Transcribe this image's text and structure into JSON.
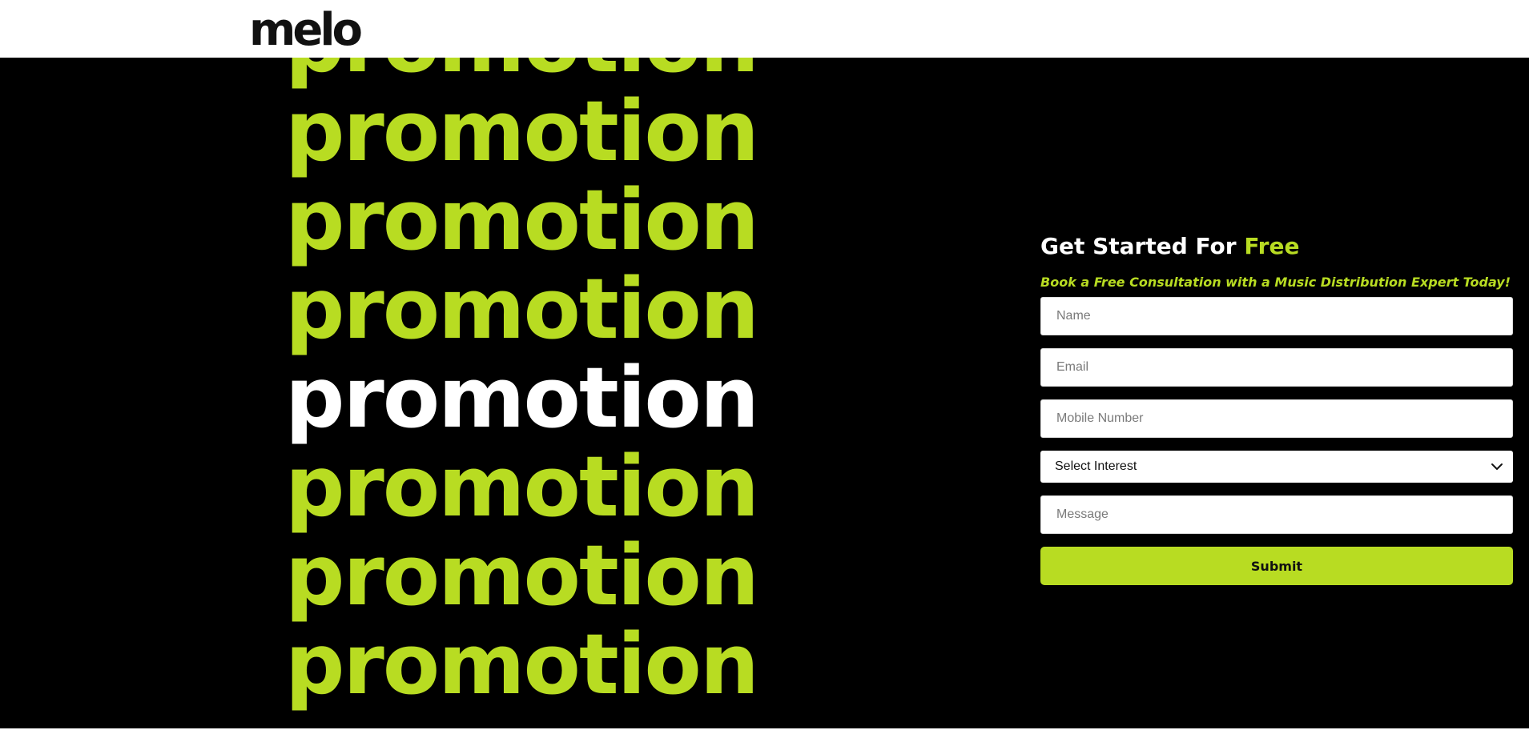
{
  "header": {
    "logo_text": "melo"
  },
  "hero": {
    "words": [
      "promotion",
      "promotion",
      "promotion",
      "promotion",
      "promotion",
      "promotion",
      "promotion",
      "promotion"
    ],
    "highlight_color": "#ffffff",
    "accent_color": "#b8dc22",
    "background_color": "#000000"
  },
  "form": {
    "title_prefix": "Get Started For ",
    "title_accent": "Free",
    "subtitle": "Book a Free Consultation with a Music Distribution Expert Today!",
    "name_placeholder": "Name",
    "email_placeholder": "Email",
    "mobile_placeholder": "Mobile Number",
    "interest_selected": "Select Interest",
    "interest_icon": "chevron-down-icon",
    "message_placeholder": "Message",
    "submit_label": "Submit"
  }
}
